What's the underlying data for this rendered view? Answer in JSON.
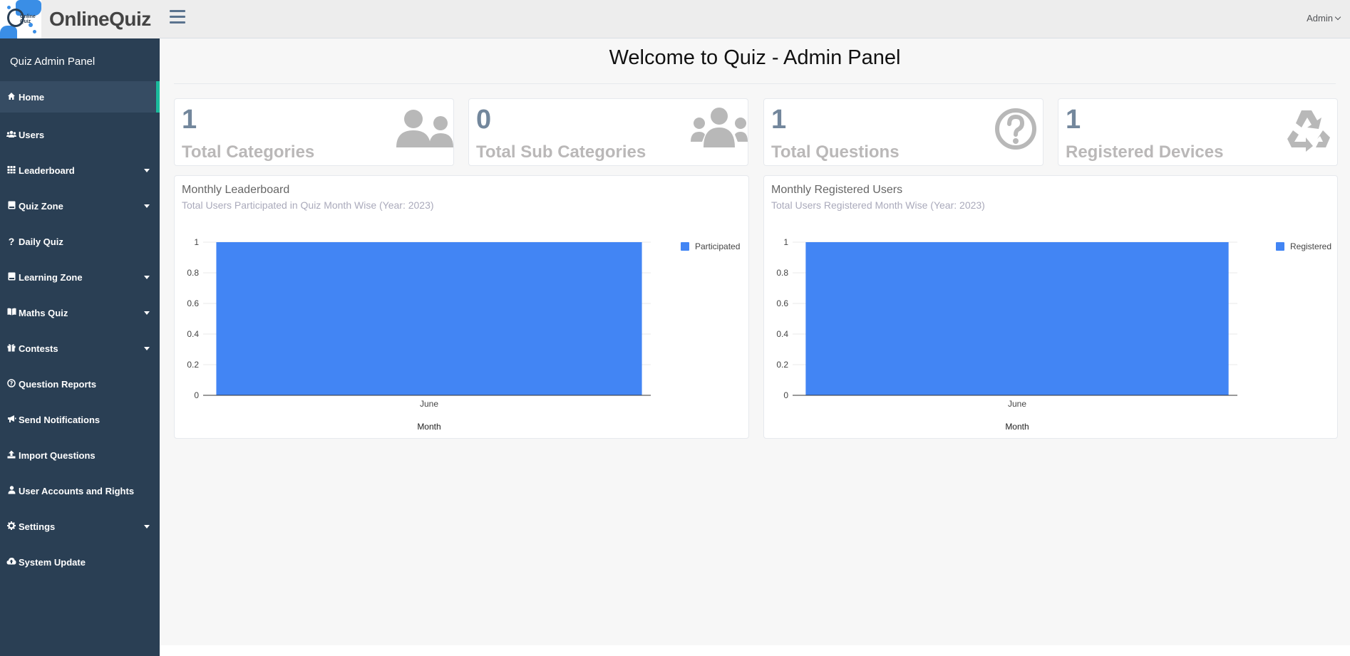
{
  "brand": {
    "name": "OnlineQuiz",
    "logo_text": "Online\nQuiz"
  },
  "sidebar": {
    "panel_title": "Quiz Admin Panel",
    "items": [
      {
        "label": "Home",
        "icon": "home-icon",
        "active": true,
        "caret": false
      },
      {
        "label": "Users",
        "icon": "users-icon",
        "active": false,
        "caret": false
      },
      {
        "label": "Leaderboard",
        "icon": "table-icon",
        "active": false,
        "caret": true
      },
      {
        "label": "Quiz Zone",
        "icon": "book-icon",
        "active": false,
        "caret": true
      },
      {
        "label": "Daily Quiz",
        "icon": "question-icon",
        "active": false,
        "caret": false
      },
      {
        "label": "Learning Zone",
        "icon": "book-icon",
        "active": false,
        "caret": true
      },
      {
        "label": "Maths Quiz",
        "icon": "open-book-icon",
        "active": false,
        "caret": true
      },
      {
        "label": "Contests",
        "icon": "gift-icon",
        "active": false,
        "caret": true
      },
      {
        "label": "Question Reports",
        "icon": "question-circle-icon",
        "active": false,
        "caret": false
      },
      {
        "label": "Send Notifications",
        "icon": "bullhorn-icon",
        "active": false,
        "caret": false
      },
      {
        "label": "Import Questions",
        "icon": "upload-icon",
        "active": false,
        "caret": false
      },
      {
        "label": "User Accounts and Rights",
        "icon": "user-icon",
        "active": false,
        "caret": false
      },
      {
        "label": "Settings",
        "icon": "gear-icon",
        "active": false,
        "caret": true
      },
      {
        "label": "System Update",
        "icon": "cloud-upload-icon",
        "active": false,
        "caret": false
      }
    ]
  },
  "topbar": {
    "user_label": "Admin"
  },
  "main": {
    "title": "Welcome to Quiz - Admin Panel",
    "tiles": [
      {
        "count": "1",
        "label": "Total Categories",
        "icon": "users-icon"
      },
      {
        "count": "0",
        "label": "Total Sub Categories",
        "icon": "users-group-icon"
      },
      {
        "count": "1",
        "label": "Total Questions",
        "icon": "question-circle-icon"
      },
      {
        "count": "1",
        "label": "Registered Devices",
        "icon": "recycle-icon"
      }
    ]
  },
  "colors": {
    "sidebar": "#2a3f54",
    "accent": "#1abb9c",
    "bar": "#4285f4",
    "tile_count": "#73879c",
    "tile_label": "#bab8b8"
  },
  "chart_data": [
    {
      "type": "bar",
      "title": "Monthly Leaderboard",
      "subtitle": "Total Users Participated in Quiz Month Wise (Year: 2023)",
      "categories": [
        "June"
      ],
      "series": [
        {
          "name": "Participated",
          "values": [
            1
          ]
        }
      ],
      "xlabel": "Month",
      "ylabel": "",
      "ylim": [
        0,
        1
      ],
      "yticks": [
        "0",
        "0.2",
        "0.4",
        "0.6",
        "0.8",
        "1"
      ],
      "legend": "right"
    },
    {
      "type": "bar",
      "title": "Monthly Registered Users",
      "subtitle": "Total Users Registered Month Wise (Year: 2023)",
      "categories": [
        "June"
      ],
      "series": [
        {
          "name": "Registered",
          "values": [
            1
          ]
        }
      ],
      "xlabel": "Month",
      "ylabel": "",
      "ylim": [
        0,
        1
      ],
      "yticks": [
        "0",
        "0.2",
        "0.4",
        "0.6",
        "0.8",
        "1"
      ],
      "legend": "right"
    }
  ]
}
